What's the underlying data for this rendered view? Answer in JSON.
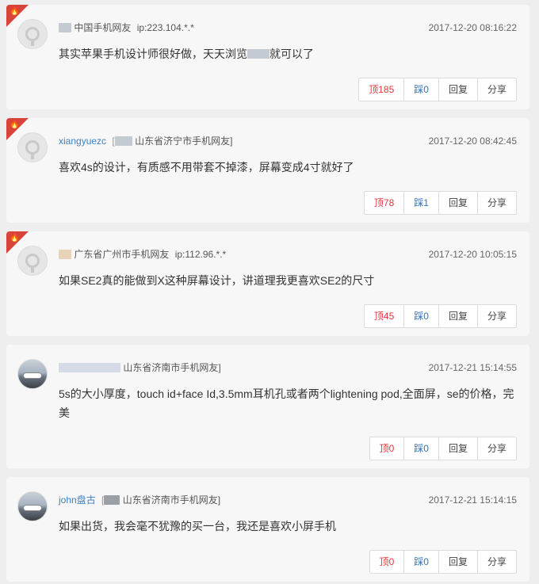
{
  "comments": [
    {
      "hot": true,
      "avatar": "default-avatar",
      "user": "",
      "location": "中国手机网友",
      "ip": "ip:223.104.*.*",
      "time": "2017-12-20 08:16:22",
      "text": "其实苹果手机设计师很好做，天天浏览",
      "text_tail": "就可以了",
      "up": "顶185",
      "down": "踩0",
      "reply": "回复",
      "share": "分享"
    },
    {
      "hot": true,
      "avatar": "default-avatar",
      "user": "xiangyuezc",
      "location": "山东省济宁市手机网友]",
      "ip": "",
      "time": "2017-12-20 08:42:45",
      "text": "喜欢4s的设计，有质感不用带套不掉漆，屏幕变成4寸就好了",
      "text_tail": "",
      "up": "顶78",
      "down": "踩1",
      "reply": "回复",
      "share": "分享"
    },
    {
      "hot": true,
      "avatar": "default-avatar",
      "user": "",
      "location": "广东省广州市手机网友",
      "ip": "ip:112.96.*.*",
      "time": "2017-12-20 10:05:15",
      "text": "如果SE2真的能做到X这种屏幕设计，讲道理我更喜欢SE2的尺寸",
      "text_tail": "",
      "up": "顶45",
      "down": "踩0",
      "reply": "回复",
      "share": "分享"
    },
    {
      "hot": false,
      "avatar": "photo-avatar",
      "user": "",
      "location": "山东省济南市手机网友]",
      "ip": "",
      "time": "2017-12-21 15:14:55",
      "text": "5s的大小厚度，touch id+face Id,3.5mm耳机孔或者两个lightening pod,全面屏，se的价格，完美",
      "text_tail": "",
      "up": "顶0",
      "down": "踩0",
      "reply": "回复",
      "share": "分享"
    },
    {
      "hot": false,
      "avatar": "photo-avatar",
      "user": "john盘古",
      "location": "山东省济南市手机网友]",
      "ip": "",
      "time": "2017-12-21 15:14:15",
      "text": "如果出货，我会毫不犹豫的买一台，我还是喜欢小屏手机",
      "text_tail": "",
      "up": "顶0",
      "down": "踩0",
      "reply": "回复",
      "share": "分享"
    }
  ]
}
